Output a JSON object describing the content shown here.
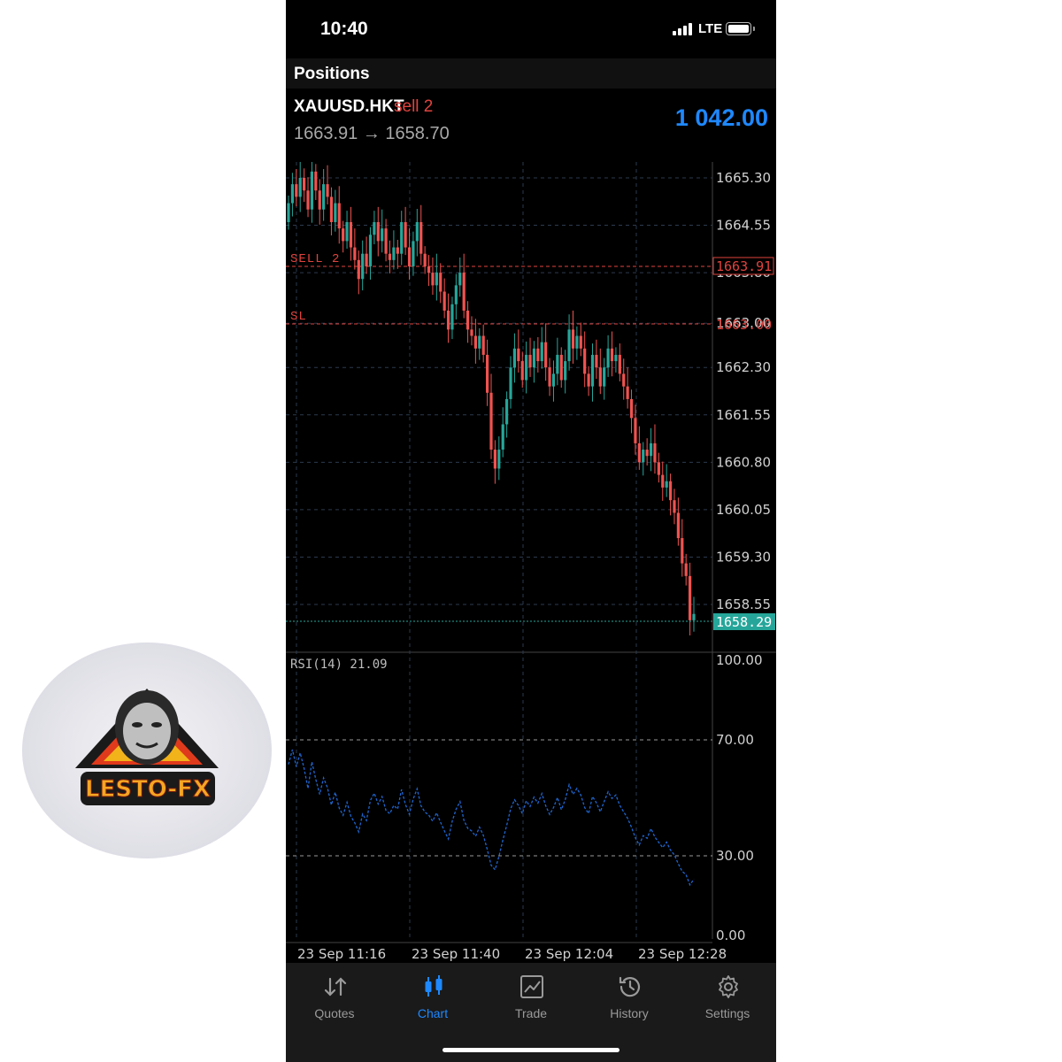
{
  "status_bar": {
    "time": "10:40",
    "network": "LTE"
  },
  "header": {
    "title": "Positions"
  },
  "position": {
    "symbol": "XAUUSD.HKT",
    "side": "sell 2",
    "open_price": "1663.91",
    "arrow": "→",
    "current_price": "1658.70",
    "profit": "1 042.00"
  },
  "chart": {
    "price_ticks": [
      "1665.30",
      "1664.55",
      "1663.80",
      "1663.00",
      "1662.30",
      "1661.55",
      "1660.80",
      "1660.05",
      "1659.30",
      "1658.55"
    ],
    "sell_line": {
      "label": "SELL 2",
      "price_tag": "1663.91",
      "color": "#e0433e"
    },
    "sl_line": {
      "label": "SL",
      "price_tag": "1663.00",
      "color": "#e0433e"
    },
    "bid_tag": "1658.29",
    "bid_color": "#26a69a",
    "bull_color": "#26a69a",
    "bear_color": "#ef5350",
    "rsi": {
      "label": "RSI(14) 21.09",
      "ticks": [
        "100.00",
        "70.00",
        "30.00",
        "0.00"
      ],
      "color": "#1e66d0"
    },
    "time_labels": [
      "23 Sep 11:16",
      "23 Sep 11:40",
      "23 Sep 12:04",
      "23 Sep 12:28"
    ]
  },
  "chart_data": {
    "type": "candlestick",
    "symbol": "XAUUSD.HKT",
    "price_axis": {
      "min": 1658.2,
      "max": 1665.5,
      "ticks": [
        1665.3,
        1664.55,
        1663.8,
        1663.0,
        1662.3,
        1661.55,
        1660.8,
        1660.05,
        1659.3,
        1658.55
      ]
    },
    "levels": {
      "sell": 1663.91,
      "sl": 1663.0,
      "bid": 1658.29
    },
    "closes": [
      1664.9,
      1665.2,
      1665.0,
      1665.3,
      1665.1,
      1664.8,
      1665.4,
      1665.1,
      1664.8,
      1665.2,
      1665.0,
      1664.6,
      1664.9,
      1664.5,
      1664.3,
      1664.6,
      1664.2,
      1664.0,
      1663.7,
      1664.1,
      1663.9,
      1664.4,
      1664.6,
      1664.3,
      1664.5,
      1664.1,
      1664.0,
      1664.2,
      1664.1,
      1664.6,
      1664.2,
      1663.9,
      1664.3,
      1664.6,
      1664.1,
      1663.9,
      1663.8,
      1663.6,
      1663.8,
      1663.5,
      1663.2,
      1662.9,
      1663.3,
      1663.6,
      1663.8,
      1663.2,
      1662.9,
      1662.8,
      1662.6,
      1662.8,
      1662.5,
      1661.9,
      1661.0,
      1660.7,
      1661.0,
      1661.4,
      1661.8,
      1662.3,
      1662.6,
      1662.4,
      1662.1,
      1662.5,
      1662.3,
      1662.6,
      1662.4,
      1662.7,
      1662.3,
      1662.0,
      1662.2,
      1662.5,
      1662.1,
      1662.4,
      1662.9,
      1662.6,
      1662.8,
      1662.6,
      1662.2,
      1662.0,
      1662.5,
      1662.3,
      1662.0,
      1662.3,
      1662.6,
      1662.4,
      1662.5,
      1662.2,
      1662.0,
      1661.8,
      1661.5,
      1661.1,
      1660.8,
      1661.0,
      1660.9,
      1661.1,
      1660.8,
      1660.6,
      1660.4,
      1660.5,
      1660.2,
      1660.0,
      1659.6,
      1659.2,
      1659.0,
      1658.3,
      1658.4
    ],
    "rsi_period": 14,
    "rsi_value": 21.09,
    "rsi_axis": {
      "min": 0,
      "max": 100,
      "levels": [
        70,
        30
      ]
    },
    "x_labels": [
      "23 Sep 11:16",
      "23 Sep 11:40",
      "23 Sep 12:04",
      "23 Sep 12:28"
    ]
  },
  "tabs": [
    {
      "label": "Quotes",
      "icon": "quotes-arrows-icon",
      "active": false
    },
    {
      "label": "Chart",
      "icon": "candlestick-icon",
      "active": true
    },
    {
      "label": "Trade",
      "icon": "trade-chart-icon",
      "active": false
    },
    {
      "label": "History",
      "icon": "history-clock-icon",
      "active": false
    },
    {
      "label": "Settings",
      "icon": "gear-icon",
      "active": false
    }
  ],
  "watermark": {
    "brand": "LESTO-FX"
  }
}
